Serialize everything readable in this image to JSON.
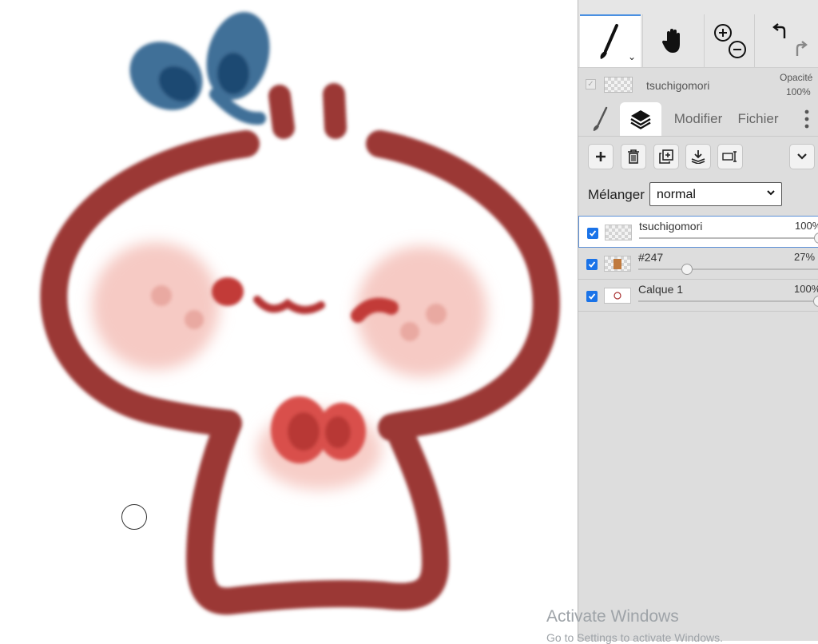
{
  "canvas": {
    "description_colors": {
      "outline": "#9b3735",
      "blush": "#f6c9c2",
      "bow": "#2f5f8a",
      "eye": "#c23b37"
    }
  },
  "panel": {
    "tools": [
      {
        "name": "brush",
        "active": true
      },
      {
        "name": "hand",
        "active": false
      },
      {
        "name": "zoom",
        "active": false
      },
      {
        "name": "undo-redo",
        "active": false
      }
    ],
    "layer_info": {
      "name": "tsuchigomori",
      "opacity_label": "Opacité",
      "opacity_value": "100%"
    },
    "tabs": {
      "modifier": "Modifier",
      "fichier": "Fichier"
    },
    "blend": {
      "label": "Mélanger",
      "value": "normal"
    },
    "layers": [
      {
        "name": "tsuchigomori",
        "opacity": "100%",
        "opacity_value": 1.0,
        "visible": true,
        "selected": true
      },
      {
        "name": "#247",
        "opacity": "27%",
        "opacity_value": 0.27,
        "visible": true,
        "selected": false
      },
      {
        "name": "Calque 1",
        "opacity": "100%",
        "opacity_value": 1.0,
        "visible": true,
        "selected": false
      }
    ],
    "accent_color": "#1a73e8"
  },
  "watermark": {
    "title": "Activate Windows",
    "subtitle": "Go to Settings to activate Windows."
  }
}
